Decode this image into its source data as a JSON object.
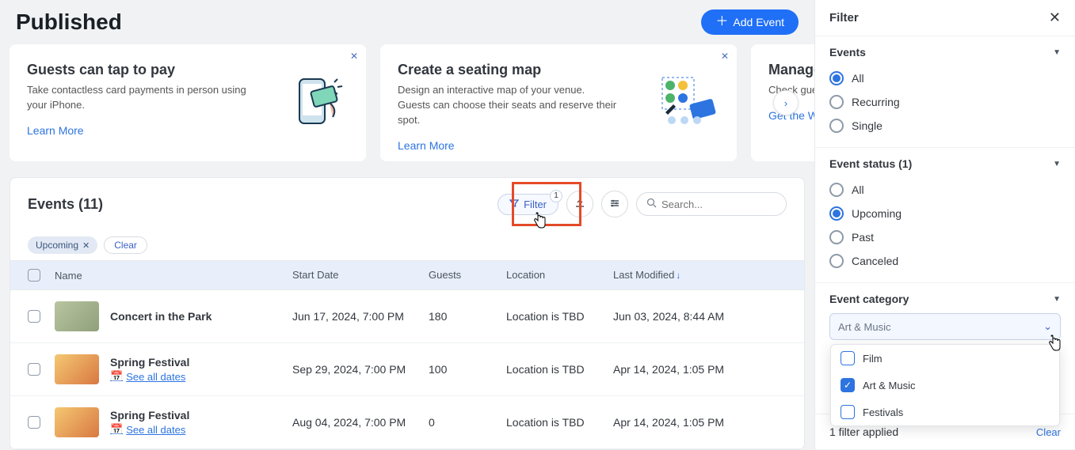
{
  "header": {
    "title": "Published",
    "add_label": "Add Event"
  },
  "cards": [
    {
      "title": "Guests can tap to pay",
      "desc": "Take contactless card payments in person using your iPhone.",
      "link": "Learn More"
    },
    {
      "title": "Create a seating map",
      "desc": "Design an interactive map of your venue. Guests can choose their seats and reserve their spot.",
      "link": "Learn More"
    },
    {
      "title": "Manage",
      "desc": "Check guest attendance",
      "link": "Get the W"
    }
  ],
  "events": {
    "heading": "Events (11)",
    "filter_label": "Filter",
    "filter_badge": "1",
    "search_placeholder": "Search...",
    "applied_tag": "Upcoming",
    "clear_label": "Clear",
    "columns": {
      "name": "Name",
      "start": "Start Date",
      "guests": "Guests",
      "location": "Location",
      "modified": "Last Modified"
    },
    "rows": [
      {
        "name": "Concert in the Park",
        "start": "Jun 17, 2024, 7:00 PM",
        "guests": "180",
        "location": "Location is TBD",
        "modified": "Jun 03, 2024, 8:44 AM",
        "see_dates": false
      },
      {
        "name": "Spring Festival",
        "start": "Sep 29, 2024, 7:00 PM",
        "guests": "100",
        "location": "Location is TBD",
        "modified": "Apr 14, 2024, 1:05 PM",
        "see_dates": true
      },
      {
        "name": "Spring Festival",
        "start": "Aug 04, 2024, 7:00 PM",
        "guests": "0",
        "location": "Location is TBD",
        "modified": "Apr 14, 2024, 1:05 PM",
        "see_dates": true
      }
    ],
    "see_dates_label": "See all dates"
  },
  "filter_panel": {
    "title": "Filter",
    "sections": {
      "events": {
        "label": "Events",
        "options": [
          "All",
          "Recurring",
          "Single"
        ],
        "selected": "All"
      },
      "status": {
        "label": "Event status (1)",
        "options": [
          "All",
          "Upcoming",
          "Past",
          "Canceled"
        ],
        "selected": "Upcoming"
      },
      "category": {
        "label": "Event category",
        "placeholder": "Art & Music",
        "options": [
          {
            "label": "Film",
            "checked": false
          },
          {
            "label": "Art & Music",
            "checked": true
          },
          {
            "label": "Festivals",
            "checked": false
          }
        ]
      }
    },
    "footer": {
      "applied": "1 filter applied",
      "clear": "Clear"
    }
  }
}
